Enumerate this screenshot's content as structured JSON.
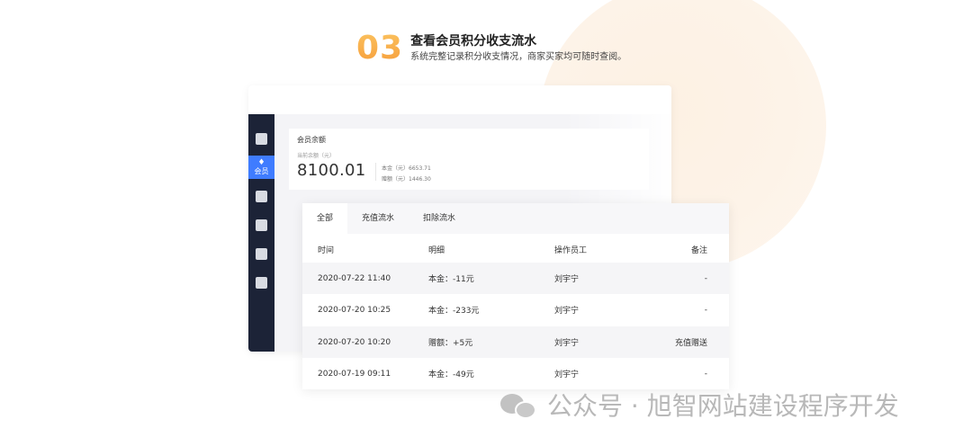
{
  "hero": {
    "number": "03",
    "title": "查看会员积分收支流水",
    "subtitle": "系统完整记录积分收支情况，商家买家均可随时查阅。"
  },
  "sidebar": {
    "active_label": "会员",
    "active_icon": "diamond-icon"
  },
  "balance": {
    "title": "会员余额",
    "current_label": "当前余额（元）",
    "amount": "8100.01",
    "principal": "本金（元）6653.71",
    "gift": "赠额（元）1446.30"
  },
  "table": {
    "tabs": [
      "全部",
      "充值流水",
      "扣除流水"
    ],
    "headers": [
      "时间",
      "明细",
      "操作员工",
      "备注"
    ],
    "rows": [
      [
        "2020-07-22 11:40",
        "本金：-11元",
        "刘宇宁",
        "-"
      ],
      [
        "2020-07-20 10:25",
        "本金：-233元",
        "刘宇宁",
        "-"
      ],
      [
        "2020-07-20 10:20",
        "赠额：+5元",
        "刘宇宁",
        "充值赠送"
      ],
      [
        "2020-07-19 09:11",
        "本金：-49元",
        "刘宇宁",
        "-"
      ]
    ]
  },
  "watermark": {
    "text": "公众号 · 旭智网站建设程序开发",
    "icon": "wechat-icon"
  },
  "colors": {
    "accent": "#f69d3a",
    "sidebar": "#1c2337",
    "active_nav": "#3f7cff"
  }
}
